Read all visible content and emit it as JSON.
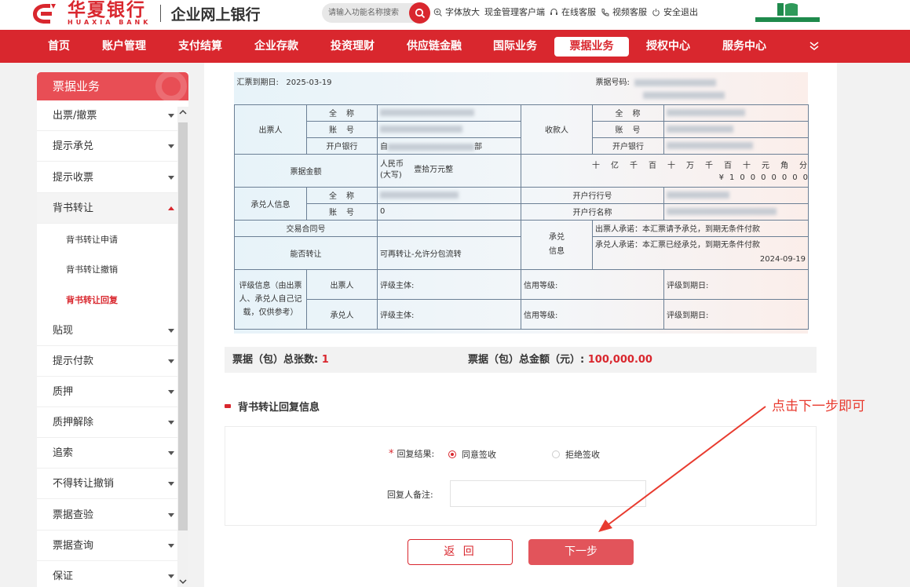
{
  "header": {
    "logo_cn": "华夏银行",
    "logo_en": "HUAXIA BANK",
    "logo_sub": "企业网上银行",
    "search_placeholder": "请输入功能名称搜索",
    "links": [
      {
        "label": "字体放大",
        "icon": "zoom-in-icon"
      },
      {
        "label": "现金管理客户端",
        "icon": ""
      },
      {
        "label": "在线客服",
        "icon": "headset-icon"
      },
      {
        "label": "视频客服",
        "icon": "phone-icon"
      },
      {
        "label": "安全退出",
        "icon": "power-icon"
      }
    ]
  },
  "nav": {
    "items": [
      "首页",
      "账户管理",
      "支付结算",
      "企业存款",
      "投资理财",
      "供应链金融",
      "国际业务",
      "票据业务",
      "授权中心",
      "服务中心"
    ],
    "active": "票据业务"
  },
  "sidebar": {
    "title": "票据业务",
    "items": [
      {
        "label": "出票/撤票"
      },
      {
        "label": "提示承兑"
      },
      {
        "label": "提示收票"
      },
      {
        "label": "背书转让",
        "open": true
      },
      {
        "label": "背书转让申请",
        "sub": true
      },
      {
        "label": "背书转让撤销",
        "sub": true
      },
      {
        "label": "背书转让回复",
        "sub": true,
        "active": true
      },
      {
        "label": "贴现"
      },
      {
        "label": "提示付款"
      },
      {
        "label": "质押"
      },
      {
        "label": "质押解除"
      },
      {
        "label": "追索"
      },
      {
        "label": "不得转让撤销"
      },
      {
        "label": "票据查验"
      },
      {
        "label": "票据查询"
      },
      {
        "label": "保证"
      }
    ]
  },
  "bill": {
    "due_label": "汇票到期日:",
    "due_date": "2025-03-19",
    "number_label": "票据号码:",
    "drawer_label": "出票人",
    "payee_label": "收款人",
    "full_name": "全　称",
    "account": "账　号",
    "bank": "开户银行",
    "drawer_bank_partial": "自",
    "drawer_bank_tail": "部",
    "amount_label": "票据金额",
    "amount_cn_prefix": "人民币\n(大写)",
    "amount_cn": "壹拾万元整",
    "unit_headers": [
      "十",
      "亿",
      "千",
      "百",
      "十",
      "万",
      "千",
      "百",
      "十",
      "元",
      "角",
      "分"
    ],
    "unit_digits": [
      "",
      "",
      "",
      "",
      "",
      "¥",
      "1",
      "0",
      "0",
      "0",
      "0",
      "0",
      "0",
      "0"
    ],
    "acceptor_label": "承兑人信息",
    "acceptor_account_value": "0",
    "acceptor_bank_no": "开户行行号",
    "acceptor_bank_name": "开户行名称",
    "contract_label": "交易合同号",
    "transferable_label": "能否转让",
    "transferable_value": "可再转让-允许分包流转",
    "accept_info_label": "承兑\n信息",
    "drawer_promise": "出票人承诺：本汇票请予承兑，到期无条件付款",
    "acceptor_promise": "承兑人承诺：本汇票已经承兑，到期无条件付款",
    "accept_date": "2024-09-19",
    "rating_label": "评级信息（由出票人、承兑人自己记载，仅供参考）",
    "rating_drawer": "出票人",
    "rating_acceptor": "承兑人",
    "rating_subject": "评级主体:",
    "credit_level": "信用等级:",
    "rating_due": "评级到期日:"
  },
  "summary": {
    "count_label": "票据（包）总张数:",
    "count": "1",
    "amount_label": "票据（包）总金额（元）:",
    "amount": "100,000.00"
  },
  "reply": {
    "section_title": "背书转让回复信息",
    "result_label": "回复结果:",
    "agree": "同意签收",
    "reject": "拒绝签收",
    "remark_label": "回复人备注:",
    "back": "返 回",
    "next": "下一步"
  },
  "annotation": "点击下一步即可",
  "colors": {
    "brand": "#d9272e",
    "annotation": "#e83b2f"
  }
}
